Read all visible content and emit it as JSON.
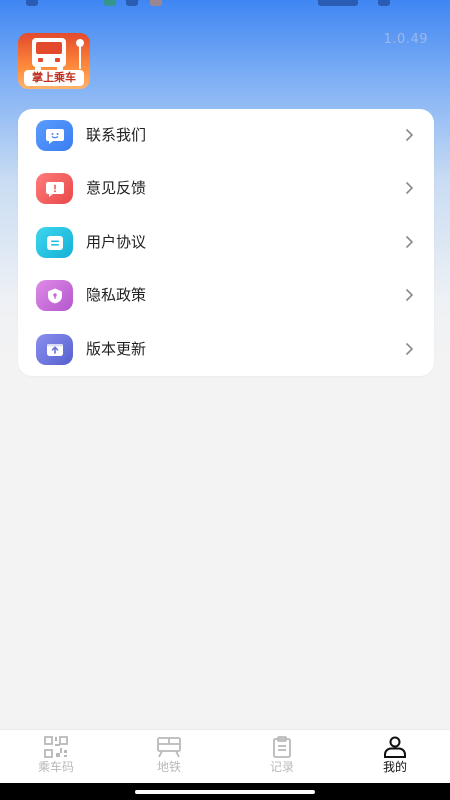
{
  "header": {
    "logo_text": "掌上乘车",
    "version": "1.0.49"
  },
  "menu": {
    "items": [
      {
        "label": "联系我们",
        "icon": "chat-smile-icon",
        "color": "#4a8af4"
      },
      {
        "label": "意见反馈",
        "icon": "feedback-alert-icon",
        "color": "#ef5f5f"
      },
      {
        "label": "用户协议",
        "icon": "document-lines-icon",
        "color": "#22c3df"
      },
      {
        "label": "隐私政策",
        "icon": "shield-icon",
        "color": "#c86bd8"
      },
      {
        "label": "版本更新",
        "icon": "upload-box-icon",
        "color": "#6b73d8"
      }
    ]
  },
  "tabbar": {
    "tabs": [
      {
        "label": "乘车码",
        "icon": "qrcode-icon",
        "active": false
      },
      {
        "label": "地铁",
        "icon": "metro-icon",
        "active": false
      },
      {
        "label": "记录",
        "icon": "clipboard-icon",
        "active": false
      },
      {
        "label": "我的",
        "icon": "user-icon",
        "active": true
      }
    ]
  },
  "colors": {
    "accent": "#3f86f3",
    "inactive_tab": "#b9b9b9",
    "active_tab": "#111111"
  }
}
